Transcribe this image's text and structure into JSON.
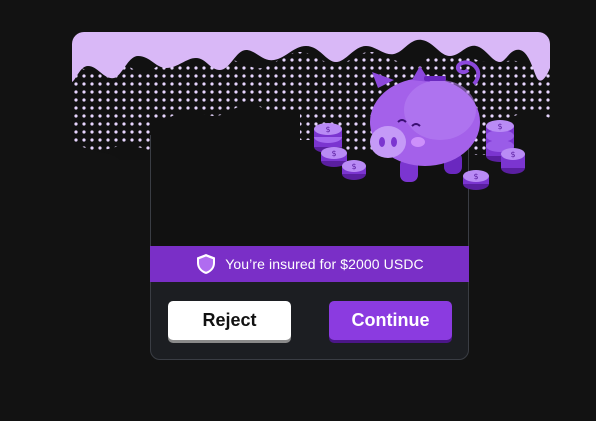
{
  "banner": {
    "text": "You’re insured for $2000 USDC",
    "icon": "shield-icon"
  },
  "buttons": {
    "reject_label": "Reject",
    "continue_label": "Continue"
  },
  "illustration": {
    "subject": "piggy-bank-icon",
    "coins_icon": "coin-icon"
  },
  "colors": {
    "background": "#121212",
    "accent_purple": "#8b3be0",
    "banner_purple": "#7a2fc7",
    "drip_lavender": "#d9b8f7",
    "card": "#1c1e22"
  }
}
